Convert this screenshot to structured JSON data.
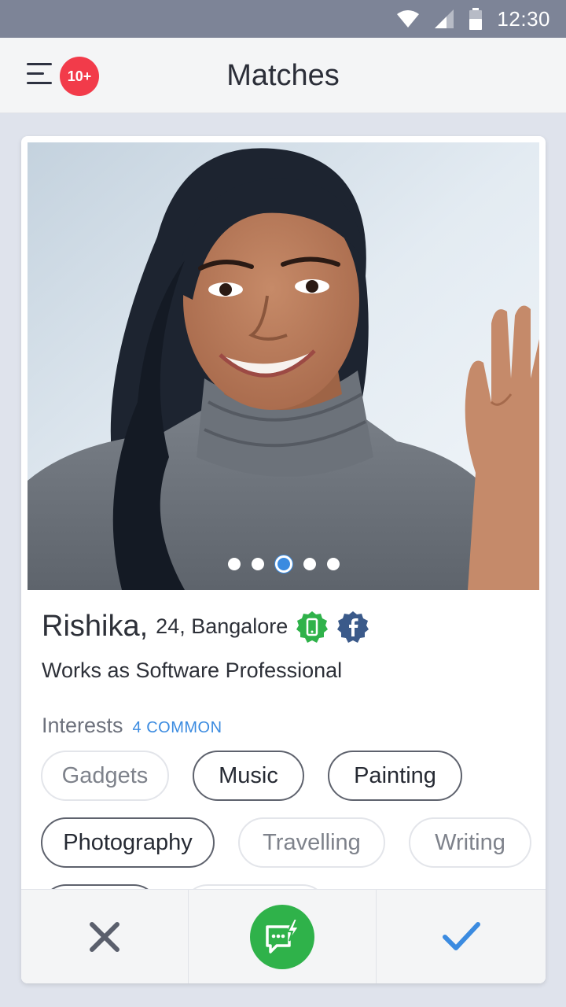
{
  "status_bar": {
    "time": "12:30",
    "icons": [
      "wifi-icon",
      "signal-icon",
      "battery-icon"
    ]
  },
  "header": {
    "title": "Matches",
    "badge": "10+",
    "menu_icon": "menu-icon"
  },
  "profile": {
    "name": "Rishika,",
    "age_city": "24, Bangalore",
    "job": "Works as Software Professional",
    "photo_count": 5,
    "active_photo": 3,
    "badges": [
      "phone-verified-icon",
      "facebook-verified-icon"
    ]
  },
  "interests": {
    "label": "Interests",
    "common": "4 COMMON",
    "items": [
      {
        "label": "Gadgets",
        "common": false
      },
      {
        "label": "Music",
        "common": true
      },
      {
        "label": "Painting",
        "common": true
      },
      {
        "label": "Photography",
        "common": true
      },
      {
        "label": "Travelling",
        "common": false
      },
      {
        "label": "Writing",
        "common": false
      }
    ]
  },
  "actions": [
    "reject-icon",
    "chat-icon",
    "accept-icon"
  ],
  "colors": {
    "accent": "#3b8be0",
    "badge": "#f23b4a",
    "chat": "#2fb24a",
    "verified_green": "#2fb24a",
    "facebook": "#3b5a8a"
  }
}
